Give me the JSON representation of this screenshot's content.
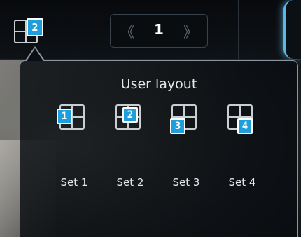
{
  "toolbar": {
    "layout_button": {
      "badge": "2",
      "icon": "grid-2x2-icon"
    },
    "pager": {
      "prev_icon": "double-chevron-left-icon",
      "next_icon": "double-chevron-right-icon",
      "prev_glyph": "《",
      "next_glyph": "》",
      "page": "1"
    }
  },
  "popup": {
    "title": "User layout",
    "sets": [
      {
        "badge": "1",
        "label": "Set 1",
        "icon": "grid-2x2-icon"
      },
      {
        "badge": "2",
        "label": "Set 2",
        "icon": "grid-2x2-icon"
      },
      {
        "badge": "3",
        "label": "Set 3",
        "icon": "grid-2x2-icon"
      },
      {
        "badge": "4",
        "label": "Set 4",
        "icon": "grid-2x2-icon"
      }
    ]
  },
  "colors": {
    "badge_bg": "#1e9fdc",
    "accent_glow": "#5ab8e6",
    "text": "#e6e9ec"
  }
}
